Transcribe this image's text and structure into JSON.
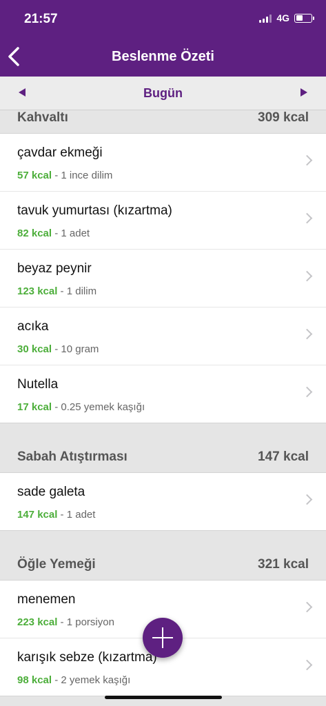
{
  "status_bar": {
    "time": "21:57",
    "network": "4G"
  },
  "header": {
    "title": "Beslenme Özeti",
    "back_icon": "chevron-left-icon"
  },
  "date_nav": {
    "label": "Bugün",
    "prev_icon": "triangle-left-icon",
    "next_icon": "triangle-right-icon"
  },
  "sections": [
    {
      "name": "Kahvaltı",
      "kcal": "309 kcal",
      "items": [
        {
          "food": "çavdar ekmeği",
          "kcal": "57 kcal",
          "portion": " - 1 ince dilim"
        },
        {
          "food": "tavuk yumurtası (kızartma)",
          "kcal": "82 kcal",
          "portion": " - 1 adet"
        },
        {
          "food": "beyaz peynir",
          "kcal": "123 kcal",
          "portion": " - 1 dilim"
        },
        {
          "food": "acıka",
          "kcal": "30 kcal",
          "portion": " - 10 gram"
        },
        {
          "food": "Nutella",
          "kcal": "17 kcal",
          "portion": " - 0.25 yemek kaşığı"
        }
      ]
    },
    {
      "name": "Sabah Atıştırması",
      "kcal": "147 kcal",
      "items": [
        {
          "food": "sade galeta",
          "kcal": "147 kcal",
          "portion": " - 1 adet"
        }
      ]
    },
    {
      "name": "Öğle Yemeği",
      "kcal": "321 kcal",
      "items": [
        {
          "food": "menemen",
          "kcal": "223 kcal",
          "portion": " - 1 porsiyon"
        },
        {
          "food": "karışık sebze (kızartma)",
          "kcal": "98 kcal",
          "portion": " - 2 yemek kaşığı"
        }
      ]
    }
  ],
  "fab": {
    "icon": "plus-icon"
  },
  "colors": {
    "brand": "#5e2081",
    "kcal_green": "#4cae3a",
    "background": "#e5e5e5"
  }
}
